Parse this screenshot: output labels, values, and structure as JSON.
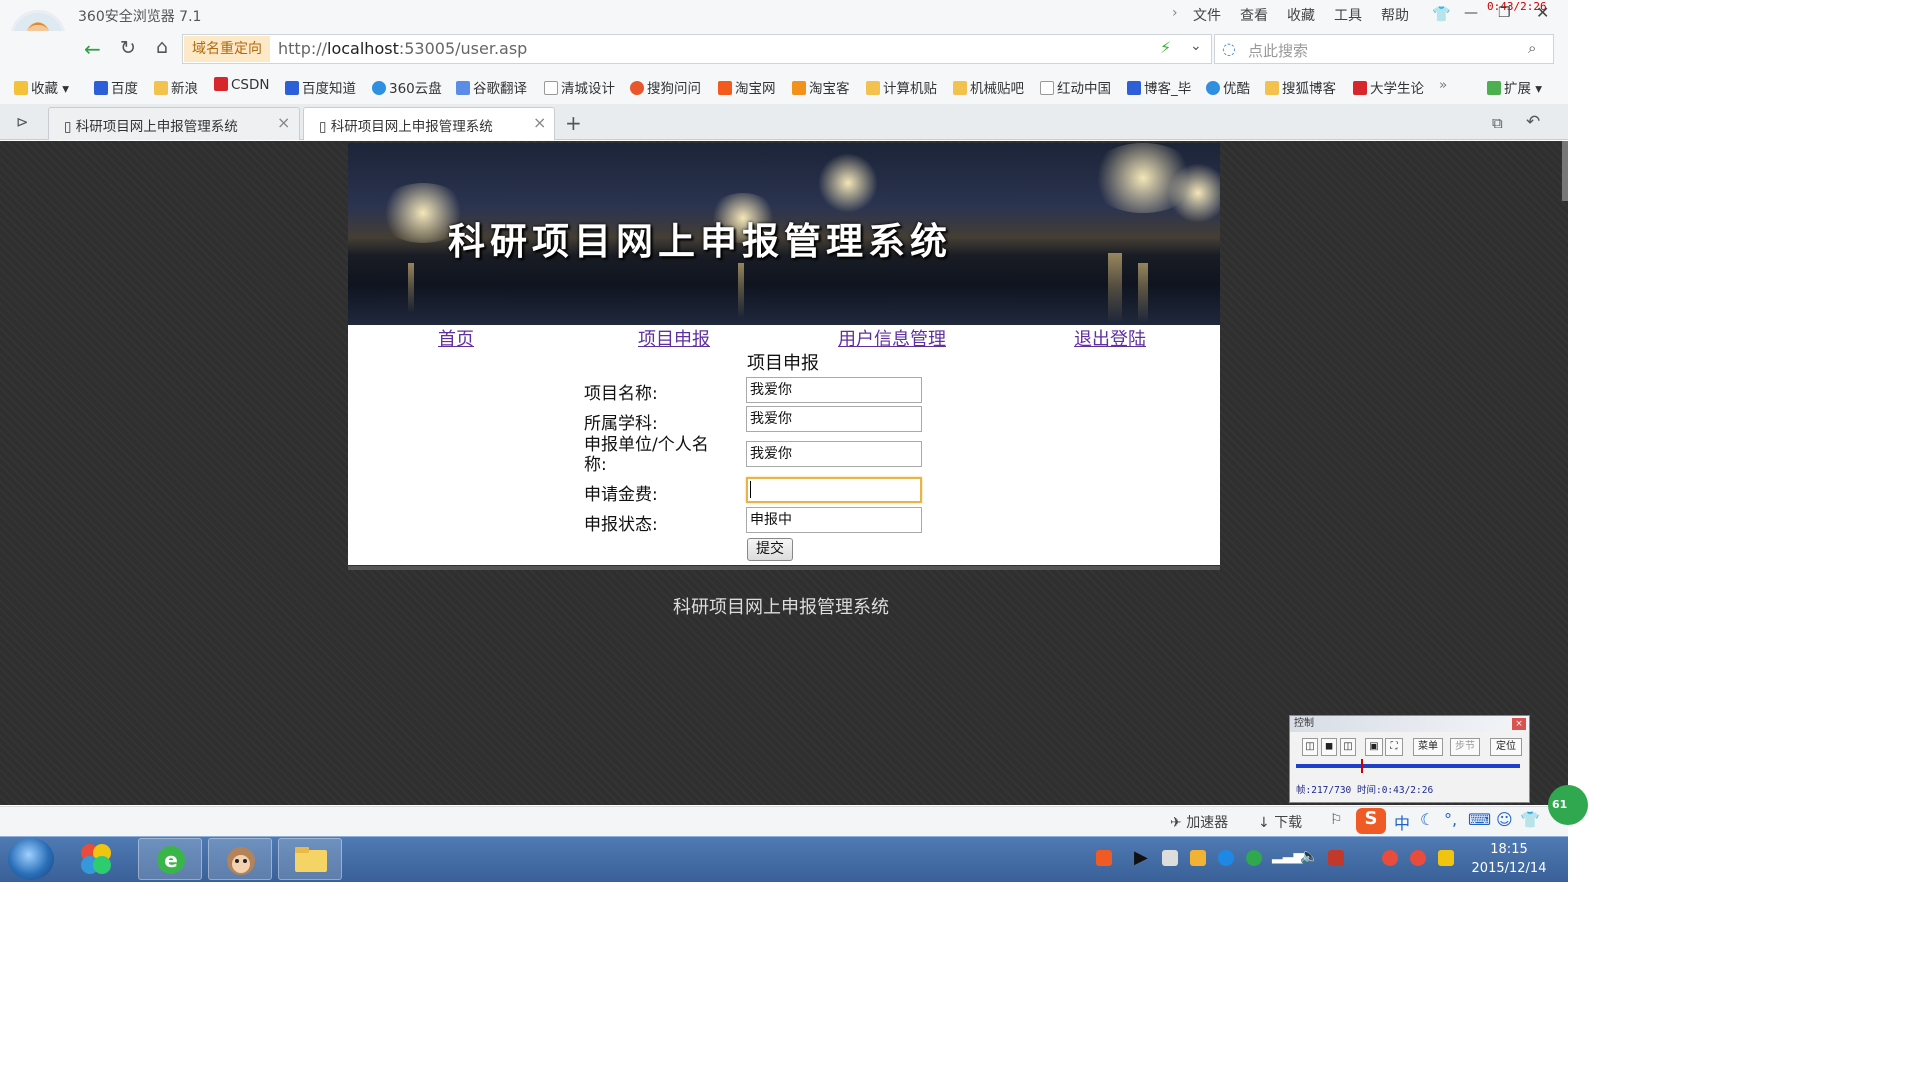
{
  "browser": {
    "app_name": "360安全浏览器 7.1",
    "menu": [
      "文件",
      "查看",
      "收藏",
      "工具",
      "帮助"
    ],
    "redirect_label": "域名重定向",
    "url_prefix": "http://",
    "url_host": "localhost",
    "url_rest": ":53005/user.asp",
    "search_placeholder": "点此搜索",
    "bookmarks": [
      "收藏",
      "百度",
      "新浪",
      "CSDN",
      "百度知道",
      "360云盘",
      "谷歌翻译",
      "清城设计",
      "搜狗问问",
      "淘宝网",
      "淘宝客",
      "计算机贴",
      "机械贴吧",
      "红动中国",
      "博客_毕",
      "优酷",
      "搜狐博客",
      "大学生论",
      "扩展"
    ],
    "tabs": [
      {
        "title": "科研项目网上申报管理系统",
        "active": false
      },
      {
        "title": "科研项目网上申报管理系统",
        "active": true
      }
    ],
    "status_items": [
      "加速器",
      "下载"
    ]
  },
  "page": {
    "banner_title": "科研项目网上申报管理系统",
    "nav": [
      "首页",
      "项目申报",
      "用户信息管理",
      "退出登陆"
    ],
    "form_title": "项目申报",
    "fields": [
      {
        "label": "项目名称:",
        "value": "我爱你"
      },
      {
        "label": "所属学科:",
        "value": "我爱你"
      },
      {
        "label": "申报单位/个人名称:",
        "value": "我爱你"
      },
      {
        "label": "申请金费:",
        "value": ""
      },
      {
        "label": "申报状态:",
        "value": "申报中"
      }
    ],
    "submit_label": "提交",
    "footer": "科研项目网上申报管理系统"
  },
  "player": {
    "title": "控制",
    "buttons": [
      "菜单",
      "步节",
      "定位"
    ],
    "status": "帧:217/730 时间:0:43/2:26",
    "overlay_time": "0:43/2:26",
    "progress": 0.29
  },
  "taskbar": {
    "time": "18:15",
    "date": "2015/12/14",
    "badge": "61"
  },
  "colors": {
    "page_bg": "#2f2f2f",
    "nav_link": "#6030a0",
    "input_focus": "#e7b44a"
  }
}
